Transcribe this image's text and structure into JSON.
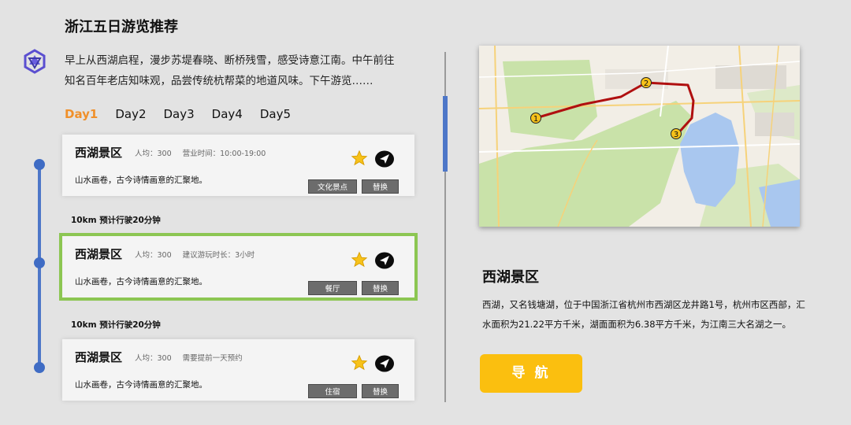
{
  "header": {
    "title": "浙江五日游览推荐"
  },
  "intro": {
    "text": "早上从西湖启程，漫步苏堤春晓、断桥残雪，感受诗意江南。中午前往知名百年老店知味观，品尝传统杭帮菜的地道风味。下午游览……"
  },
  "tabs": [
    {
      "label": "Day1",
      "active": true
    },
    {
      "label": "Day2"
    },
    {
      "label": "Day3"
    },
    {
      "label": "Day4"
    },
    {
      "label": "Day5"
    }
  ],
  "cards": [
    {
      "name": "西湖景区",
      "avg": "人均：300",
      "info": "营业时间：10:00-19:00",
      "desc": "山水画卷，古今诗情画意的汇聚地。",
      "tag": "文化景点",
      "replace": "替换"
    },
    {
      "name": "西湖景区",
      "avg": "人均：300",
      "info": "建议游玩时长：3小时",
      "desc": "山水画卷，古今诗情画意的汇聚地。",
      "tag": "餐厅",
      "replace": "替换"
    },
    {
      "name": "西湖景区",
      "avg": "人均：300",
      "info": "需要提前一天预约",
      "desc": "山水画卷，古今诗情画意的汇聚地。",
      "tag": "住宿",
      "replace": "替换"
    }
  ],
  "drives": [
    "10km 预计行驶20分钟",
    "10km 预计行驶20分钟"
  ],
  "map": {
    "markers": [
      "1",
      "2",
      "3"
    ],
    "route_color": "#b01010",
    "water_color": "#a9c7ef",
    "park_color": "#c9e2a9"
  },
  "detail": {
    "name": "西湖景区",
    "desc": "西湖，又名钱塘湖，位于中国浙江省杭州市西湖区龙井路1号，杭州市区西部，汇水面积为21.22平方千米，湖面面积为6.38平方千米，为江南三大名湖之一。",
    "nav_label": "导 航"
  },
  "colors": {
    "accent": "#f0902a",
    "timeline": "#4e77c8",
    "selected": "#8cc652",
    "nav_button": "#fbbf0f"
  }
}
